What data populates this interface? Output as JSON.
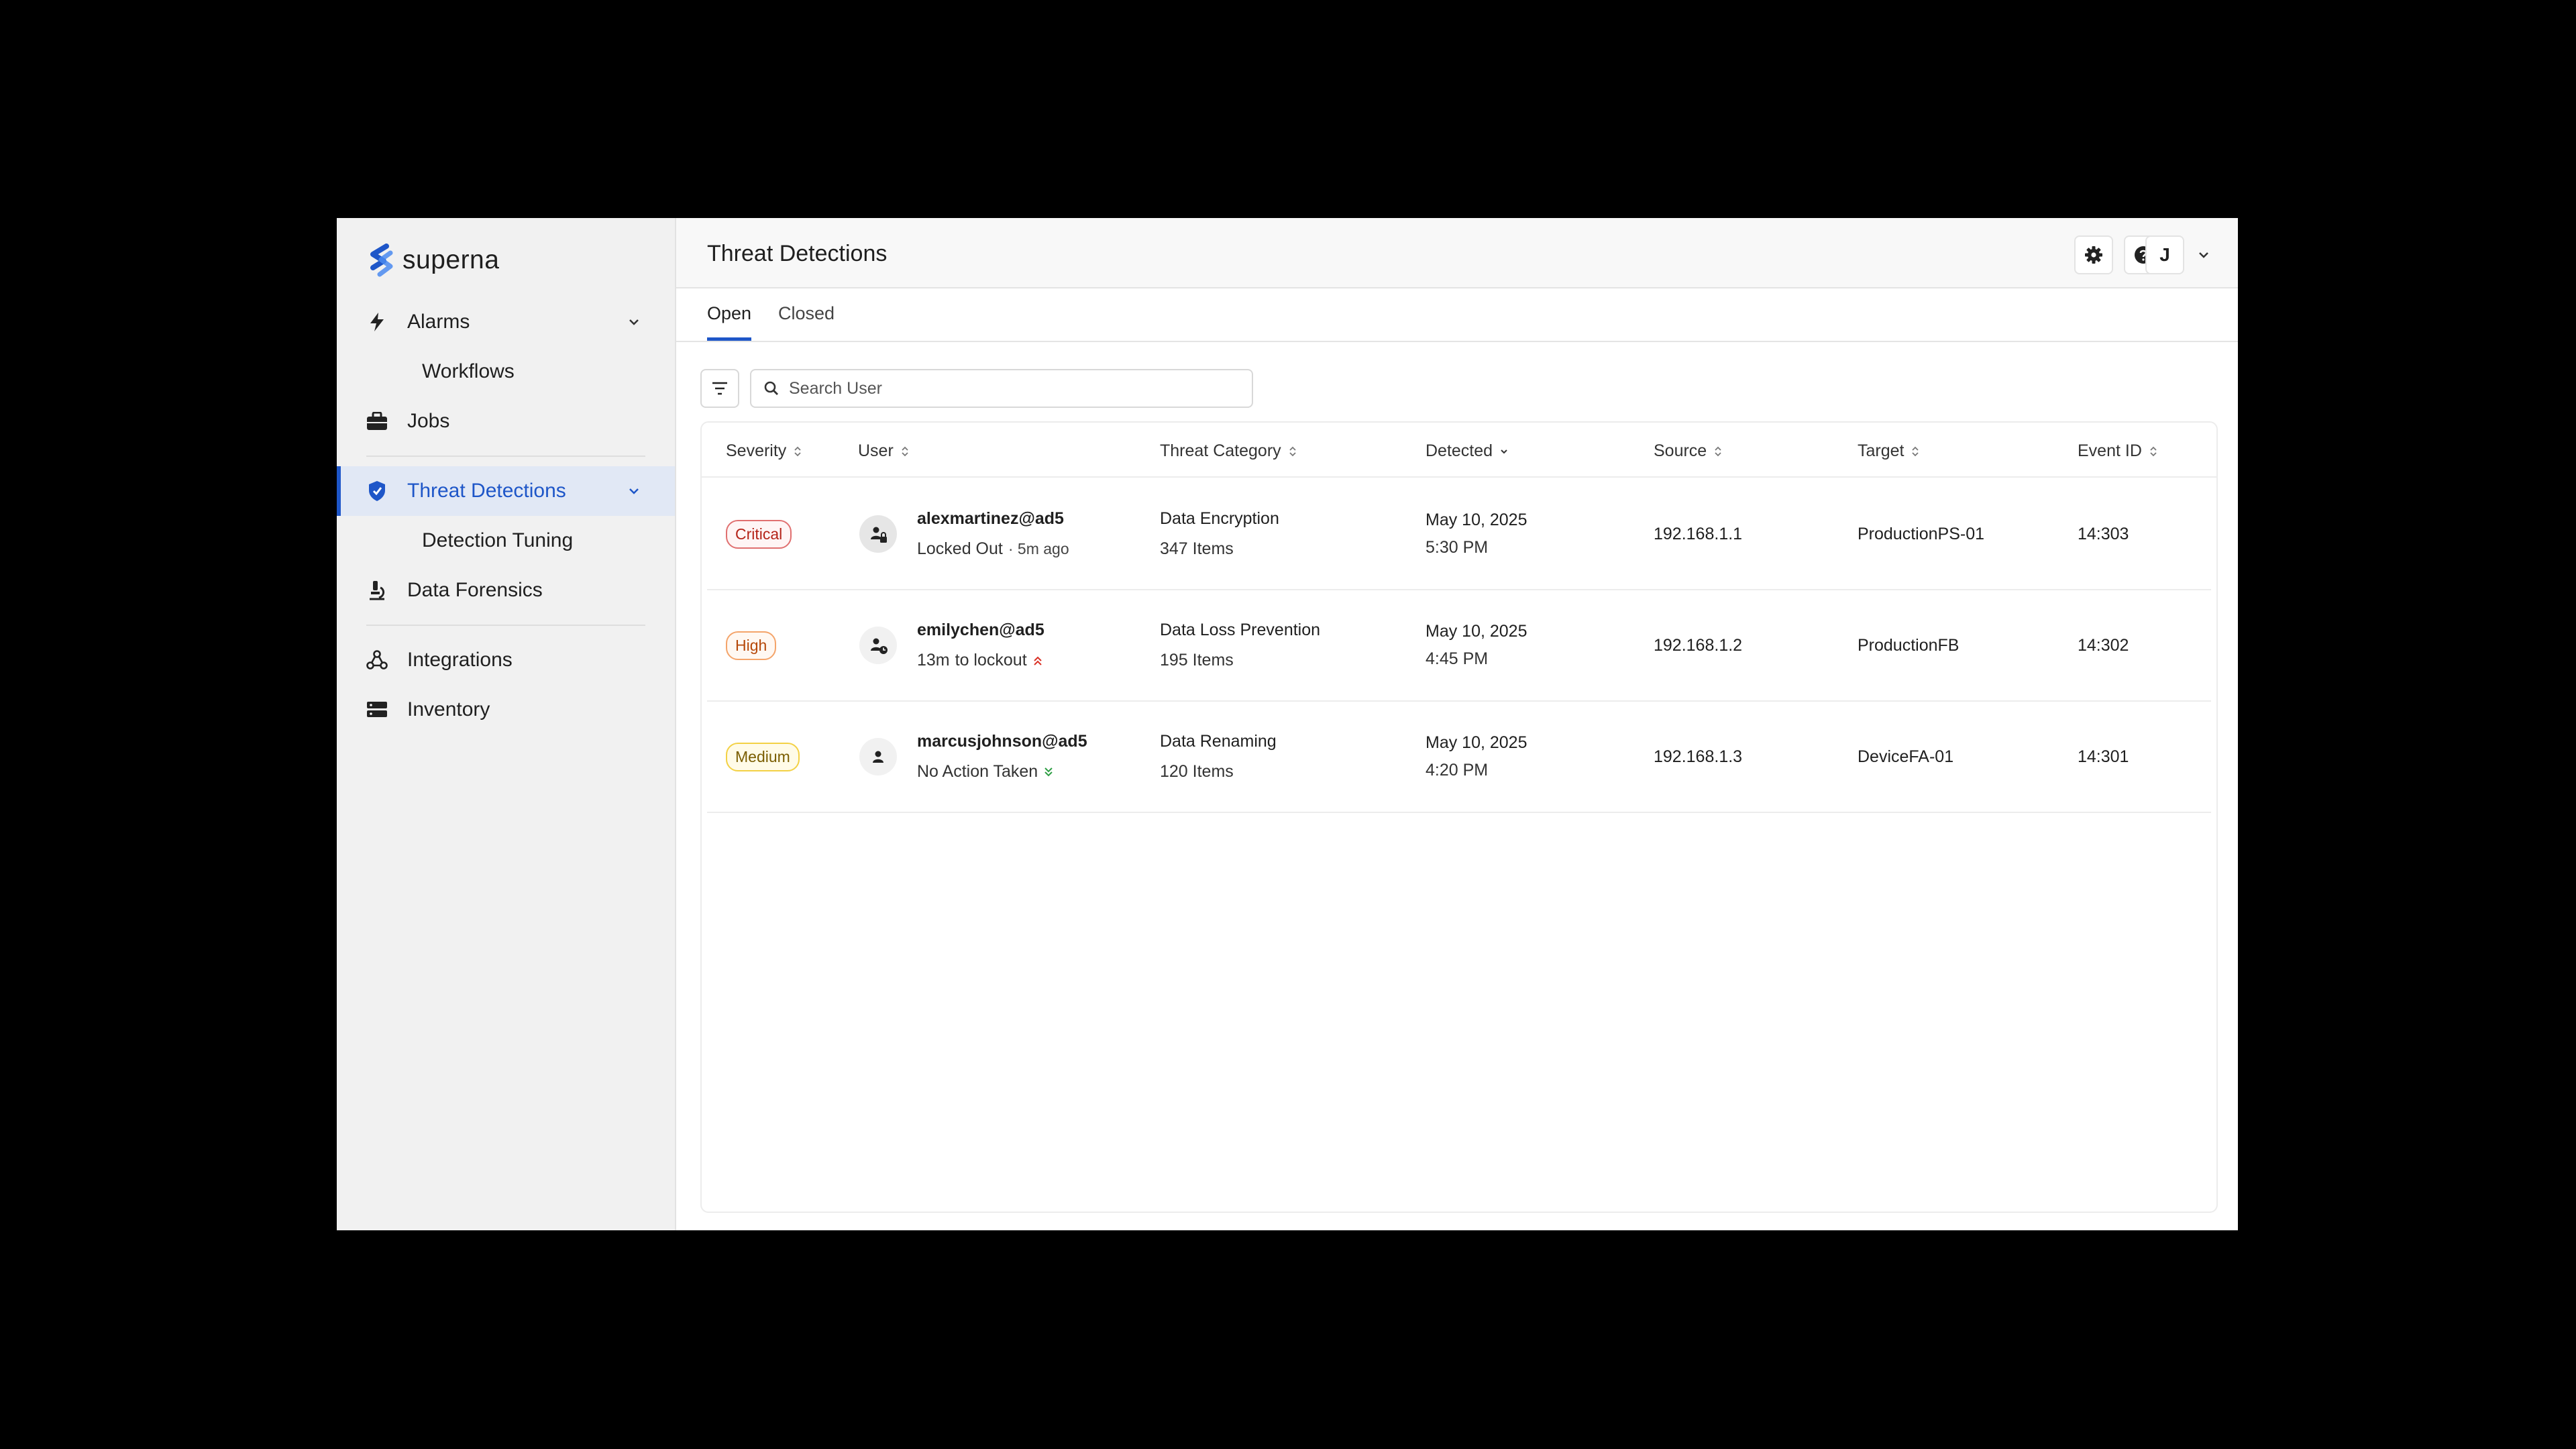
{
  "app": {
    "logo_text": "superna"
  },
  "sidebar": {
    "items": [
      {
        "label": "Alarms",
        "icon": "bolt-icon"
      },
      {
        "label": "Workflows"
      },
      {
        "label": "Jobs",
        "icon": "briefcase-icon"
      },
      {
        "label": "Threat Detections",
        "icon": "shield-icon"
      },
      {
        "label": "Detection Tuning"
      },
      {
        "label": "Data Forensics",
        "icon": "microscope-icon"
      },
      {
        "label": "Integrations",
        "icon": "integrations-icon"
      },
      {
        "label": "Inventory",
        "icon": "server-icon"
      }
    ]
  },
  "header": {
    "title": "Threat Detections",
    "user_initial": "J"
  },
  "tabs": [
    {
      "label": "Open"
    },
    {
      "label": "Closed"
    }
  ],
  "search": {
    "placeholder": "Search User"
  },
  "table": {
    "columns": [
      "Severity",
      "User",
      "Threat Category",
      "Detected",
      "Source",
      "Target",
      "Event ID"
    ],
    "rows": [
      {
        "severity": "Critical",
        "user": "alexmartinez@ad5",
        "status": "Locked Out",
        "status_extra": "· 5m ago",
        "category": "Data Encryption",
        "items": "347 Items",
        "date": "May 10, 2025",
        "time": "5:30 PM",
        "source": "192.168.1.1",
        "target": "ProductionPS-01",
        "event_id": "14:303"
      },
      {
        "severity": "High",
        "user": "emilychen@ad5",
        "status": "13m",
        "status_extra": "to lockout",
        "category": "Data Loss Prevention",
        "items": "195 Items",
        "date": "May 10, 2025",
        "time": "4:45 PM",
        "source": "192.168.1.2",
        "target": "ProductionFB",
        "event_id": "14:302"
      },
      {
        "severity": "Medium",
        "user": "marcusjohnson@ad5",
        "status": "No Action Taken",
        "status_extra": "",
        "category": "Data Renaming",
        "items": "120 Items",
        "date": "May 10, 2025",
        "time": "4:20 PM",
        "source": "192.168.1.3",
        "target": "DeviceFA-01",
        "event_id": "14:301"
      }
    ]
  },
  "colors": {
    "accent": "#1e56c8",
    "critical": "#b42318",
    "high": "#b54708",
    "medium": "#7a5d00",
    "escalate": "#d93025",
    "deescalate": "#2e9e44"
  }
}
